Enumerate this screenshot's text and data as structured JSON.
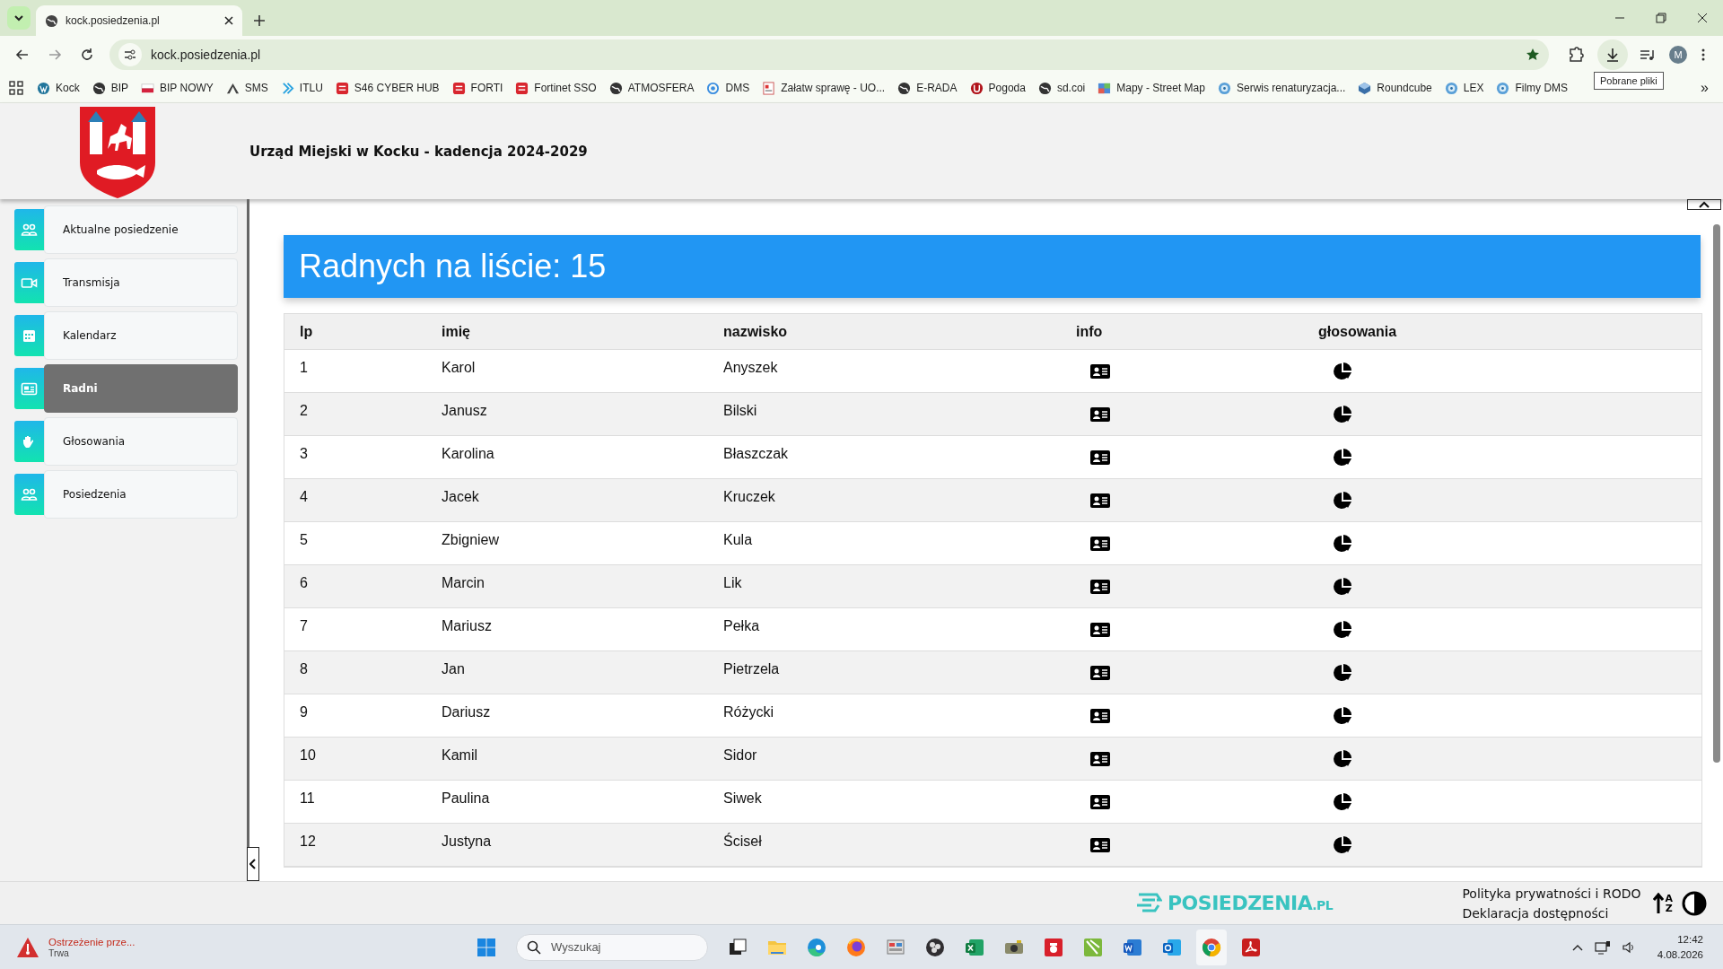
{
  "browser": {
    "tabs": [
      {
        "title": "kock.posiedzenia.pl",
        "selected": true
      }
    ],
    "url": "kock.posiedzenia.pl",
    "profile_initial": "M",
    "tooltip": "Pobrane pliki",
    "bookmarks": [
      {
        "label": "Kock"
      },
      {
        "label": "BIP"
      },
      {
        "label": "BIP NOWY"
      },
      {
        "label": "SMS"
      },
      {
        "label": "ITLU"
      },
      {
        "label": "S46 CYBER HUB"
      },
      {
        "label": "FORTI"
      },
      {
        "label": "Fortinet SSO"
      },
      {
        "label": "ATMOSFERA"
      },
      {
        "label": "DMS"
      },
      {
        "label": "Załatw sprawę - UO..."
      },
      {
        "label": "E-RADA"
      },
      {
        "label": "Pogoda"
      },
      {
        "label": "sd.coi"
      },
      {
        "label": "Mapy - Street Map"
      },
      {
        "label": "Serwis renaturyzacja..."
      },
      {
        "label": "Roundcube"
      },
      {
        "label": "LEX"
      },
      {
        "label": "Filmy DMS"
      }
    ],
    "more_bookmarks": "»"
  },
  "header": {
    "title": "Urząd Miejski w Kocku - kadencja 2024-2029"
  },
  "sidebar": {
    "items": [
      {
        "label": "Aktualne posiedzenie",
        "selected": false
      },
      {
        "label": "Transmisja",
        "selected": false
      },
      {
        "label": "Kalendarz",
        "selected": false
      },
      {
        "label": "Radni",
        "selected": true
      },
      {
        "label": "Głosowania",
        "selected": false
      },
      {
        "label": "Posiedzenia",
        "selected": false
      }
    ]
  },
  "banner": {
    "title": "Radnych na liście: 15"
  },
  "table": {
    "columns": [
      "lp",
      "imię",
      "nazwisko",
      "info",
      "głosowania"
    ],
    "rows": [
      {
        "lp": "1",
        "first_name": "Karol",
        "last_name": "Anyszek"
      },
      {
        "lp": "2",
        "first_name": "Janusz",
        "last_name": "Bilski"
      },
      {
        "lp": "3",
        "first_name": "Karolina",
        "last_name": "Błaszczak"
      },
      {
        "lp": "4",
        "first_name": "Jacek",
        "last_name": "Kruczek"
      },
      {
        "lp": "5",
        "first_name": "Zbigniew",
        "last_name": "Kula"
      },
      {
        "lp": "6",
        "first_name": "Marcin",
        "last_name": "Lik"
      },
      {
        "lp": "7",
        "first_name": "Mariusz",
        "last_name": "Pełka"
      },
      {
        "lp": "8",
        "first_name": "Jan",
        "last_name": "Pietrzela"
      },
      {
        "lp": "9",
        "first_name": "Dariusz",
        "last_name": "Różycki"
      },
      {
        "lp": "10",
        "first_name": "Kamil",
        "last_name": "Sidor"
      },
      {
        "lp": "11",
        "first_name": "Paulina",
        "last_name": "Siwek"
      },
      {
        "lp": "12",
        "first_name": "Justyna",
        "last_name": "Ściseł"
      }
    ]
  },
  "footer": {
    "logo_text": "POSIEDZENIA",
    "logo_suffix": ".PL",
    "links": [
      "Polityka prywatności i RODO",
      "Deklaracja dostępności"
    ],
    "sort_letters": [
      "A",
      "Z"
    ]
  },
  "taskbar": {
    "alert_title": "Ostrzeżenie prze...",
    "alert_subtitle": "Trwa",
    "search_placeholder": "Wyszukaj",
    "time": "12:42",
    "date": "4.08.2026"
  }
}
